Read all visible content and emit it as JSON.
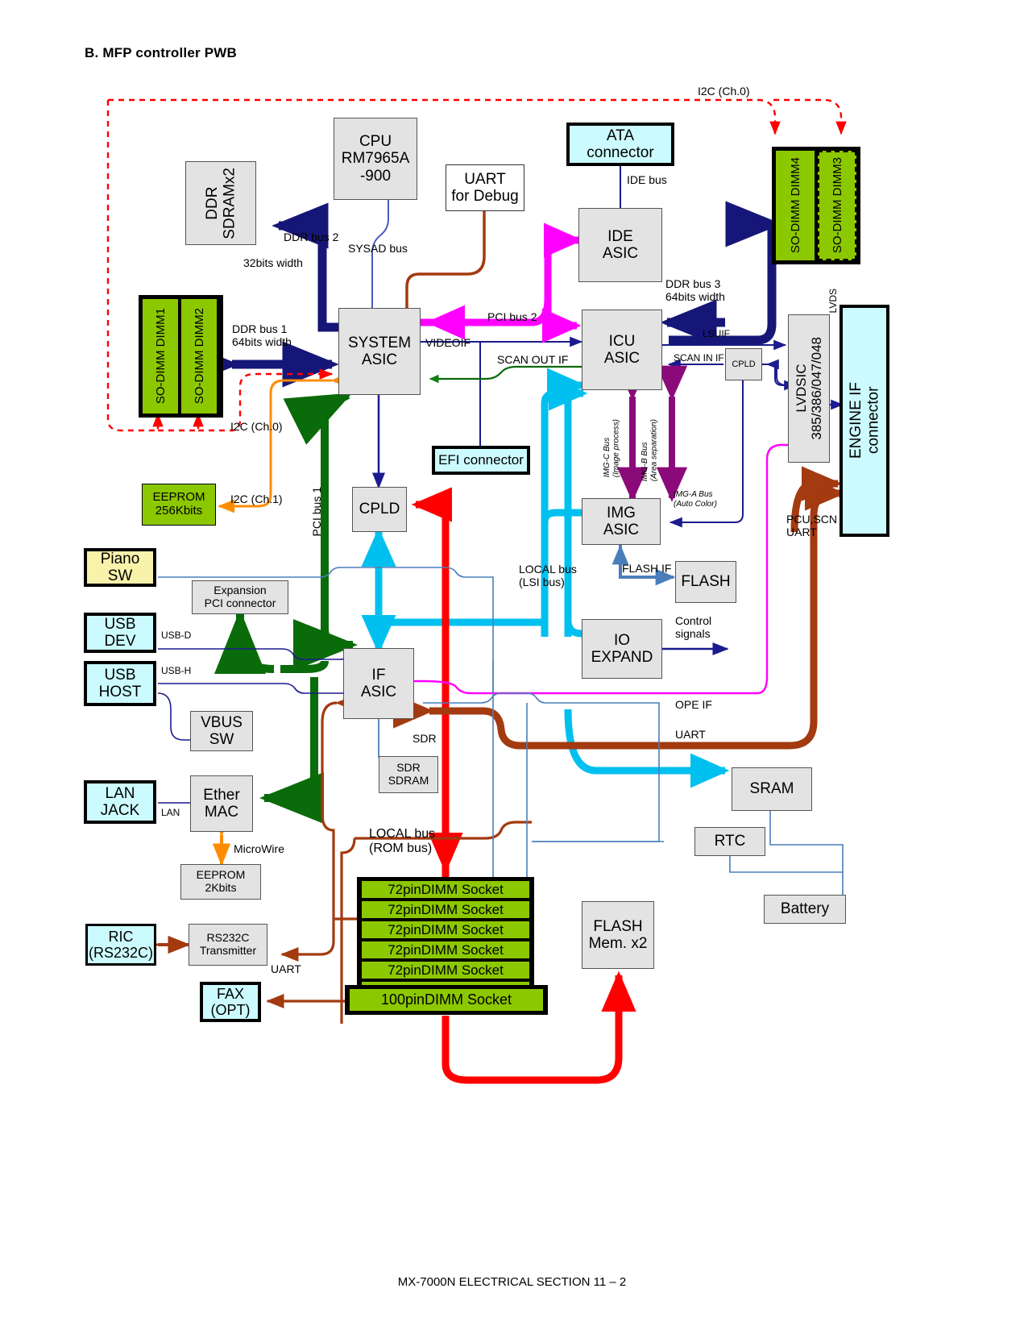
{
  "page": {
    "heading": "B.  MFP controller PWB",
    "footer": "MX-7000N  ELECTRICAL SECTION  11 – 2"
  },
  "colors": {
    "grey_fill": "#e3e3e3",
    "green_fill": "#8cc800",
    "cyan_fill": "#ccfbff",
    "yellow_fill": "#f8f2ab",
    "navy": "#1b1b8f",
    "darkblue_bus": "#161678",
    "magenta": "#ff00ff",
    "cyan_bus": "#00c0f0",
    "green_bus": "#108010",
    "red": "#ff0000",
    "brown": "#a33a10",
    "orange": "#ff8c00",
    "purple": "#8b0a7a",
    "steel": "#4a7ebb"
  },
  "blocks": {
    "cpu": "CPU\nRM7965A\n-900",
    "ddr_sdram": "DDR\nSDRAMx2",
    "uart_debug": "UART\nfor Debug",
    "ata_connector": "ATA\nconnector",
    "ide_asic": "IDE\nASIC",
    "system_asic": "SYSTEM\nASIC",
    "icu_asic": "ICU\nASIC",
    "img_asic": "IMG\nASIC",
    "cpld_top": "CPLD",
    "cpld_mid": "CPLD",
    "lvdsic": "LVDSIC\n385/386/047/048",
    "engine_if": "ENGINE IF\nconnector",
    "efi_connector": "EFI connector",
    "eeprom_256k": "EEPROM\n256Kbits",
    "eeprom_2k": "EEPROM\n2Kbits",
    "piano_sw": "Piano\nSW",
    "usb_dev": "USB\nDEV",
    "usb_host": "USB\nHOST",
    "vbus_sw": "VBUS\nSW",
    "lan_jack": "LAN\nJACK",
    "ether_mac": "Ether\nMAC",
    "ric_rs232c": "RIC\n(RS232C)",
    "rs232c_tx": "RS232C\nTransmitter",
    "fax_opt": "FAX\n(OPT)",
    "expansion_pci": "Expansion\nPCI connector",
    "if_asic": "IF\nASIC",
    "sdr_sdram": "SDR\nSDRAM",
    "io_expand": "IO\nEXPAND",
    "flash": "FLASH",
    "sram": "SRAM",
    "rtc": "RTC",
    "battery": "Battery",
    "flash_mem_x2": "FLASH\nMem. x2",
    "sodimm1": "SO-DIMM\nDIMM1",
    "sodimm2": "SO-DIMM\nDIMM2",
    "sodimm3": "SO-DIMM\nDIMM3",
    "sodimm4": "SO-DIMM\nDIMM4"
  },
  "sockets": {
    "pin72_label": "72pinDIMM Socket",
    "pin72_count": 6,
    "pin100_label": "100pinDIMM Socket"
  },
  "bus_labels": {
    "i2c_ch0_top": "I2C (Ch.0)",
    "i2c_ch0_left": "I2C (Ch.0)",
    "i2c_ch1": "I2C (Ch.1)",
    "ddr_bus_2": "DDR bus 2",
    "bits32_width": "32bits width",
    "sysad_bus": "SYSAD bus",
    "ddr_bus_1": "DDR bus 1\n64bits width",
    "ddr_bus_3": "DDR bus 3\n64bits width",
    "ide_bus": "IDE bus",
    "pci_bus_2": "PCI bus 2",
    "pci_bus_1": "PCI bus 1",
    "videoif": "VIDEOIF",
    "scan_out_if": "SCAN OUT IF",
    "scan_in_if": "SCAN IN IF",
    "lsuif": "LSUIF",
    "lvds": "LVDS",
    "img_c_bus": "IMG-C Bus\n(Image process)",
    "img_b_bus": "IMG-B Bus\n(Area separation)",
    "img_a_bus": "IMG-A Bus\n(Auto Color)",
    "local_bus_lsi": "LOCAL bus\n(LSI bus)",
    "local_bus_rom": "LOCAL bus\n(ROM bus)",
    "flash_if": "FLASH IF",
    "control_signals": "Control\nsignals",
    "ope_if": "OPE IF",
    "uart_right": "UART",
    "uart_bottom": "UART",
    "pcu_scn_uart": "PCU,SCN\nUART",
    "usb_d": "USB-D",
    "usb_h": "USB-H",
    "lan": "LAN",
    "microwire": "MicroWire",
    "sdr": "SDR"
  }
}
